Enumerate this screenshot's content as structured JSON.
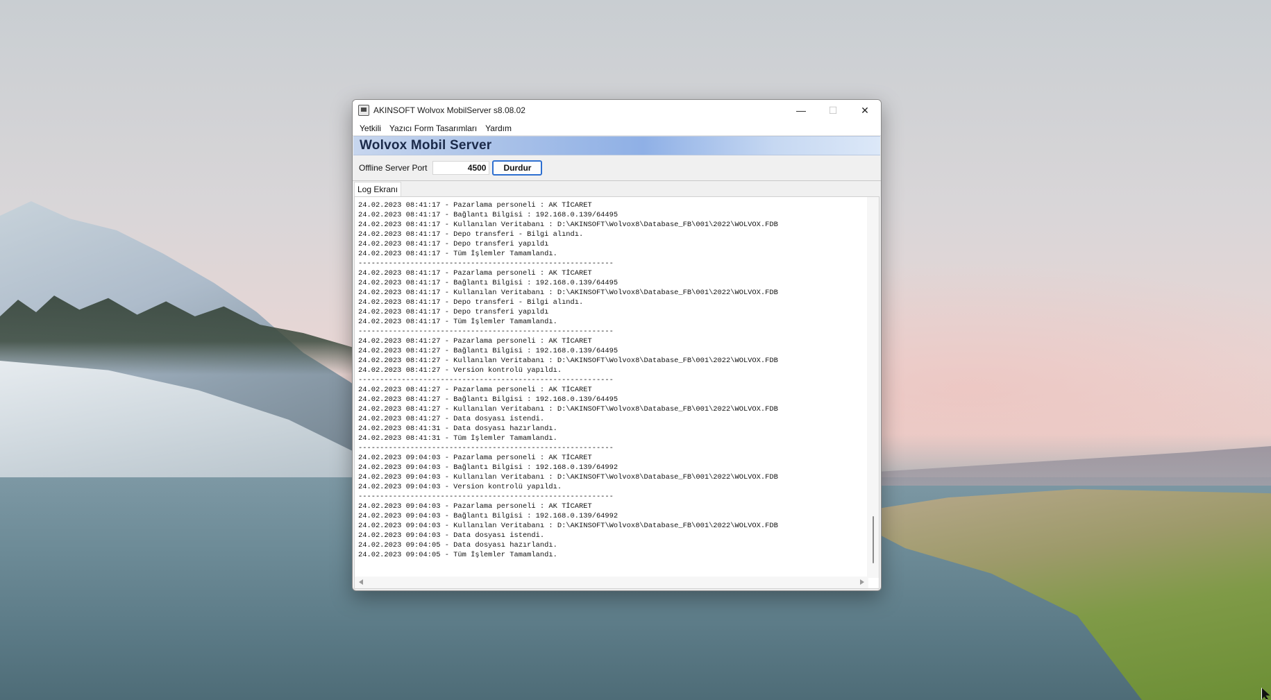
{
  "window": {
    "title": "AKINSOFT Wolvox MobilServer s8.08.02",
    "minimize": "—",
    "maximize": "☐",
    "close": "✕"
  },
  "menu": [
    "Yetkili",
    "Yazıcı Form Tasarımları",
    "Yardım"
  ],
  "banner": {
    "title": "Wolvox Mobil Server"
  },
  "port_panel": {
    "label": "Offline Server Port",
    "value": "4500",
    "stop_label": "Durdur"
  },
  "tab": {
    "label": "Log Ekranı"
  },
  "log_lines": [
    "24.02.2023 08:41:17 - Pazarlama personeli : AK TİCARET",
    "24.02.2023 08:41:17 - Bağlantı Bilgisi : 192.168.0.139/64495",
    "24.02.2023 08:41:17 - Kullanılan Veritabanı : D:\\AKINSOFT\\Wolvox8\\Database_FB\\001\\2022\\WOLVOX.FDB",
    "24.02.2023 08:41:17 - Depo transferi - Bilgi alındı.",
    "24.02.2023 08:41:17 - Depo transferi yapıldı",
    "24.02.2023 08:41:17 - Tüm İşlemler Tamamlandı.",
    "-----------------------------------------------------------",
    "24.02.2023 08:41:17 - Pazarlama personeli : AK TİCARET",
    "24.02.2023 08:41:17 - Bağlantı Bilgisi : 192.168.0.139/64495",
    "24.02.2023 08:41:17 - Kullanılan Veritabanı : D:\\AKINSOFT\\Wolvox8\\Database_FB\\001\\2022\\WOLVOX.FDB",
    "24.02.2023 08:41:17 - Depo transferi - Bilgi alındı.",
    "24.02.2023 08:41:17 - Depo transferi yapıldı",
    "24.02.2023 08:41:17 - Tüm İşlemler Tamamlandı.",
    "-----------------------------------------------------------",
    "24.02.2023 08:41:27 - Pazarlama personeli : AK TİCARET",
    "24.02.2023 08:41:27 - Bağlantı Bilgisi : 192.168.0.139/64495",
    "24.02.2023 08:41:27 - Kullanılan Veritabanı : D:\\AKINSOFT\\Wolvox8\\Database_FB\\001\\2022\\WOLVOX.FDB",
    "24.02.2023 08:41:27 - Version kontrolü yapıldı.",
    "-----------------------------------------------------------",
    "24.02.2023 08:41:27 - Pazarlama personeli : AK TİCARET",
    "24.02.2023 08:41:27 - Bağlantı Bilgisi : 192.168.0.139/64495",
    "24.02.2023 08:41:27 - Kullanılan Veritabanı : D:\\AKINSOFT\\Wolvox8\\Database_FB\\001\\2022\\WOLVOX.FDB",
    "24.02.2023 08:41:27 - Data dosyası istendi.",
    "24.02.2023 08:41:31 - Data dosyası hazırlandı.",
    "24.02.2023 08:41:31 - Tüm İşlemler Tamamlandı.",
    "-----------------------------------------------------------",
    "24.02.2023 09:04:03 - Pazarlama personeli : AK TİCARET",
    "24.02.2023 09:04:03 - Bağlantı Bilgisi : 192.168.0.139/64992",
    "24.02.2023 09:04:03 - Kullanılan Veritabanı : D:\\AKINSOFT\\Wolvox8\\Database_FB\\001\\2022\\WOLVOX.FDB",
    "24.02.2023 09:04:03 - Version kontrolü yapıldı.",
    "-----------------------------------------------------------",
    "24.02.2023 09:04:03 - Pazarlama personeli : AK TİCARET",
    "24.02.2023 09:04:03 - Bağlantı Bilgisi : 192.168.0.139/64992",
    "24.02.2023 09:04:03 - Kullanılan Veritabanı : D:\\AKINSOFT\\Wolvox8\\Database_FB\\001\\2022\\WOLVOX.FDB",
    "24.02.2023 09:04:03 - Data dosyası istendi.",
    "24.02.2023 09:04:05 - Data dosyası hazırlandı.",
    "24.02.2023 09:04:05 - Tüm İşlemler Tamamlandı."
  ],
  "icons": {
    "app": "app-icon",
    "minimize": "minimize-icon",
    "maximize": "maximize-icon",
    "close": "close-icon"
  },
  "colors": {
    "banner_text": "#1b2a4a",
    "button_border": "#2d6fd0"
  }
}
